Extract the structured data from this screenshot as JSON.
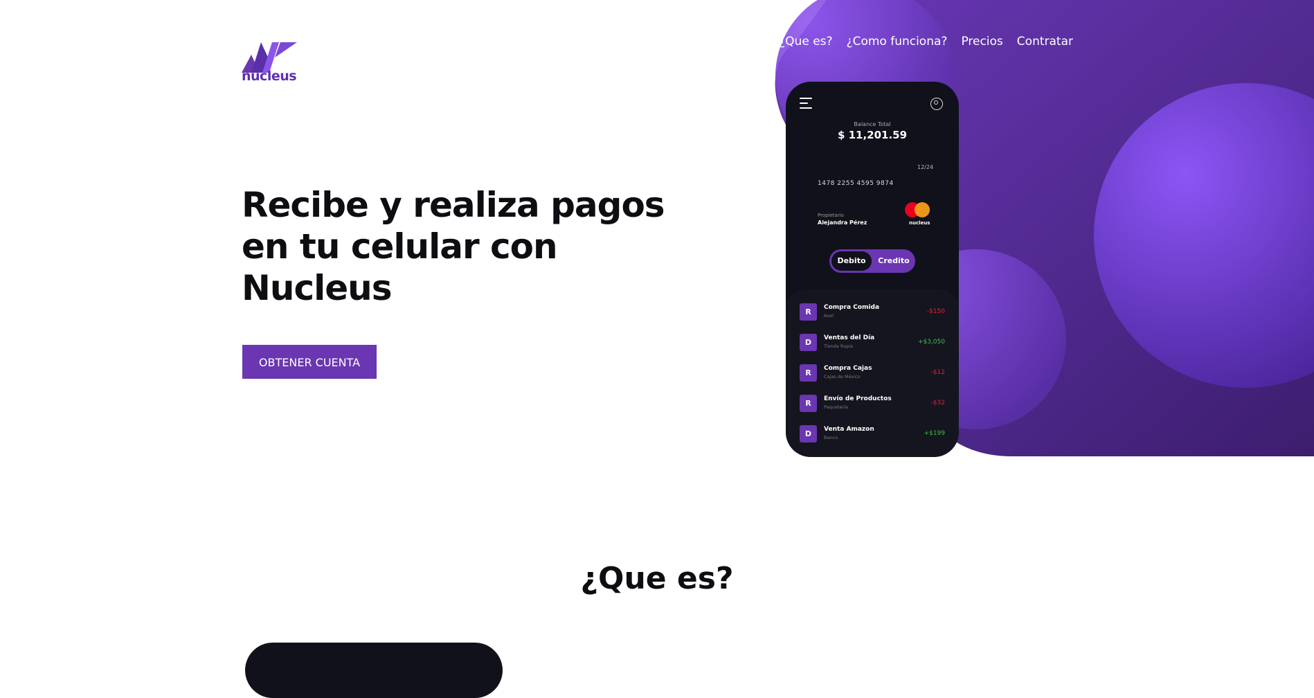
{
  "brand": {
    "name": "nucleus"
  },
  "nav": {
    "items": [
      "¿Que es?",
      "¿Como funciona?",
      "Precios",
      "Contratar"
    ]
  },
  "hero": {
    "title_lines": [
      "Recibe y realiza pagos",
      "en tu celular con",
      "Nucleus"
    ],
    "cta_label": "OBTENER CUENTA"
  },
  "section": {
    "title": "¿Que es?"
  },
  "phone": {
    "balance_label": "Balance Total",
    "balance": "$ 11,201.59",
    "card": {
      "expiry": "12/24",
      "number": "1478 2255 4595 9874",
      "owner_label": "Propietario",
      "owner": "Alejandra Pérez",
      "brand": "nucleus"
    },
    "toggle": {
      "active": "Debito",
      "inactive": "Credito"
    },
    "transactions": [
      {
        "badge": "R",
        "name": "Compra Comida",
        "sub": "Axel",
        "amount": "-$150",
        "type": "neg"
      },
      {
        "badge": "D",
        "name": "Ventas del Día",
        "sub": "Tienda Rapia",
        "amount": "+$3,050",
        "type": "pos"
      },
      {
        "badge": "R",
        "name": "Compra Cajas",
        "sub": "Cajas de México",
        "amount": "-$12",
        "type": "neg"
      },
      {
        "badge": "R",
        "name": "Envío de Productos",
        "sub": "Paquetería",
        "amount": "-$32",
        "type": "neg"
      },
      {
        "badge": "D",
        "name": "Venta Amazon",
        "sub": "Banco",
        "amount": "+$199",
        "type": "pos"
      }
    ]
  },
  "colors": {
    "accent": "#6a36b1",
    "phone_bg": "#11111b",
    "negative": "#e0243a",
    "positive": "#36c24a"
  }
}
